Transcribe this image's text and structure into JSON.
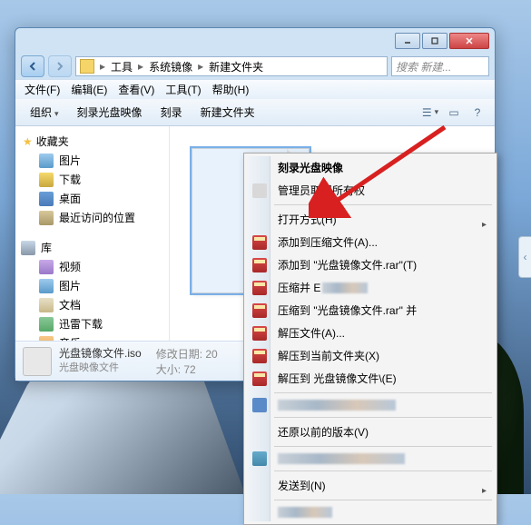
{
  "breadcrumb": {
    "seg1": "工具",
    "seg2": "系统镜像",
    "seg3": "新建文件夹"
  },
  "search": {
    "placeholder": "搜索 新建..."
  },
  "menu": {
    "file": "文件(F)",
    "edit": "编辑(E)",
    "view": "查看(V)",
    "tools": "工具(T)",
    "help": "帮助(H)"
  },
  "toolbar": {
    "organize": "组织",
    "burn": "刻录光盘映像",
    "actual_burn": "刻录",
    "newfolder": "新建文件夹"
  },
  "sidebar": {
    "fav": "收藏夹",
    "favitems": [
      "图片",
      "下载",
      "桌面",
      "最近访问的位置"
    ],
    "lib": "库",
    "libitems": [
      "视频",
      "图片",
      "文档",
      "迅雷下载",
      "音乐"
    ]
  },
  "file": {
    "name": "光盘镜像文件.iso",
    "type": "光盘映像文件",
    "date_label": "修改日期:",
    "date_val": "20",
    "size_label": "大小:",
    "size_val": "72"
  },
  "context": {
    "burn": "刻录光盘映像",
    "admin": "管理员取得所有权",
    "openwith": "打开方式(H)",
    "addarchive": "添加到压缩文件(A)...",
    "addrar": "添加到 \"光盘镜像文件.rar\"(T)",
    "compress_email": "压缩并 E",
    "compress_to": "压缩到 \"光盘镜像文件.rar\" 并",
    "extract": "解压文件(A)...",
    "extract_here": "解压到当前文件夹(X)",
    "extract_to": "解压到 光盘镜像文件\\(E)",
    "restore": "还原以前的版本(V)",
    "sendto": "发送到(N)"
  }
}
